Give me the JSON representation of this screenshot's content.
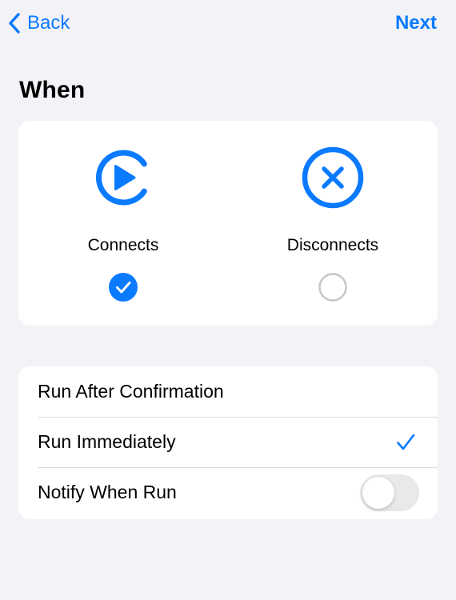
{
  "nav": {
    "back_label": "Back",
    "next_label": "Next"
  },
  "title": "When",
  "colors": {
    "accent": "#0A7AFF",
    "background": "#F2F2F7",
    "card": "#FFFFFF",
    "separator": "#DCDCE0",
    "toggle_off": "#E9E9EA"
  },
  "triggers": [
    {
      "label": "Connects",
      "icon": "play-circle-icon",
      "selected": true
    },
    {
      "label": "Disconnects",
      "icon": "x-circle-icon",
      "selected": false
    }
  ],
  "settings": {
    "rows": [
      {
        "label": "Run After Confirmation",
        "checked": false
      },
      {
        "label": "Run Immediately",
        "checked": true
      },
      {
        "label": "Notify When Run",
        "toggle_on": false
      }
    ]
  }
}
